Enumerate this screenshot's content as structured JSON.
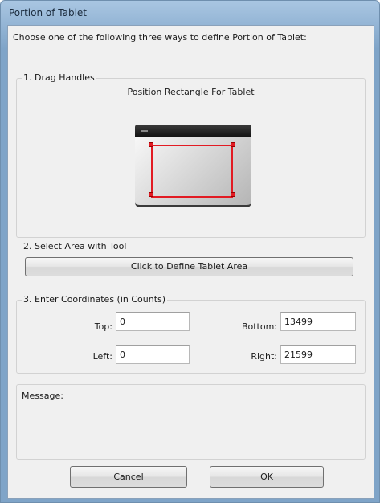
{
  "window": {
    "title": "Portion of Tablet"
  },
  "intro": "Choose one of the following three ways to define Portion of Tablet:",
  "section1": {
    "label": "1. Drag Handles",
    "caption": "Position Rectangle For Tablet"
  },
  "section2": {
    "label": "2. Select Area with Tool",
    "button": "Click to Define Tablet Area"
  },
  "section3": {
    "label": "3. Enter Coordinates (in Counts)",
    "top_label": "Top:",
    "top_value": "0",
    "bottom_label": "Bottom:",
    "bottom_value": "13499",
    "left_label": "Left:",
    "left_value": "0",
    "right_label": "Right:",
    "right_value": "21599"
  },
  "message": {
    "label": "Message:"
  },
  "buttons": {
    "cancel": "Cancel",
    "ok": "OK"
  },
  "colors": {
    "selection": "#e21b23",
    "titlebar": "#a9c6e2"
  }
}
